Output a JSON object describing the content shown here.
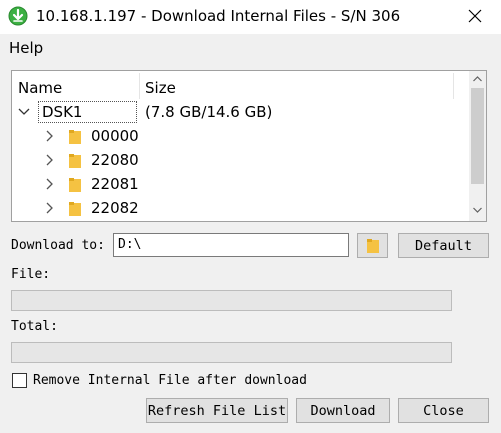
{
  "window": {
    "title": "10.168.1.197 - Download Internal Files - S/N 306"
  },
  "menu": {
    "help": "Help"
  },
  "tree": {
    "columns": {
      "name": "Name",
      "size": "Size"
    },
    "drive": {
      "label": "DSK1",
      "size": "(7.8 GB/14.6 GB)"
    },
    "folders": [
      {
        "label": "00000"
      },
      {
        "label": "22080"
      },
      {
        "label": "22081"
      },
      {
        "label": "22082"
      }
    ]
  },
  "download": {
    "label": "Download to:",
    "path": "D:\\",
    "default_button": "Default"
  },
  "file": {
    "label": "File:",
    "progress": 0
  },
  "total": {
    "label": "Total:",
    "progress": 0
  },
  "options": {
    "remove_label": "Remove Internal File after download",
    "remove_checked": false
  },
  "buttons": {
    "refresh": "Refresh File List",
    "download": "Download",
    "close": "Close"
  },
  "colors": {
    "folder": "#f5c242",
    "app_icon": "#3cb043"
  }
}
